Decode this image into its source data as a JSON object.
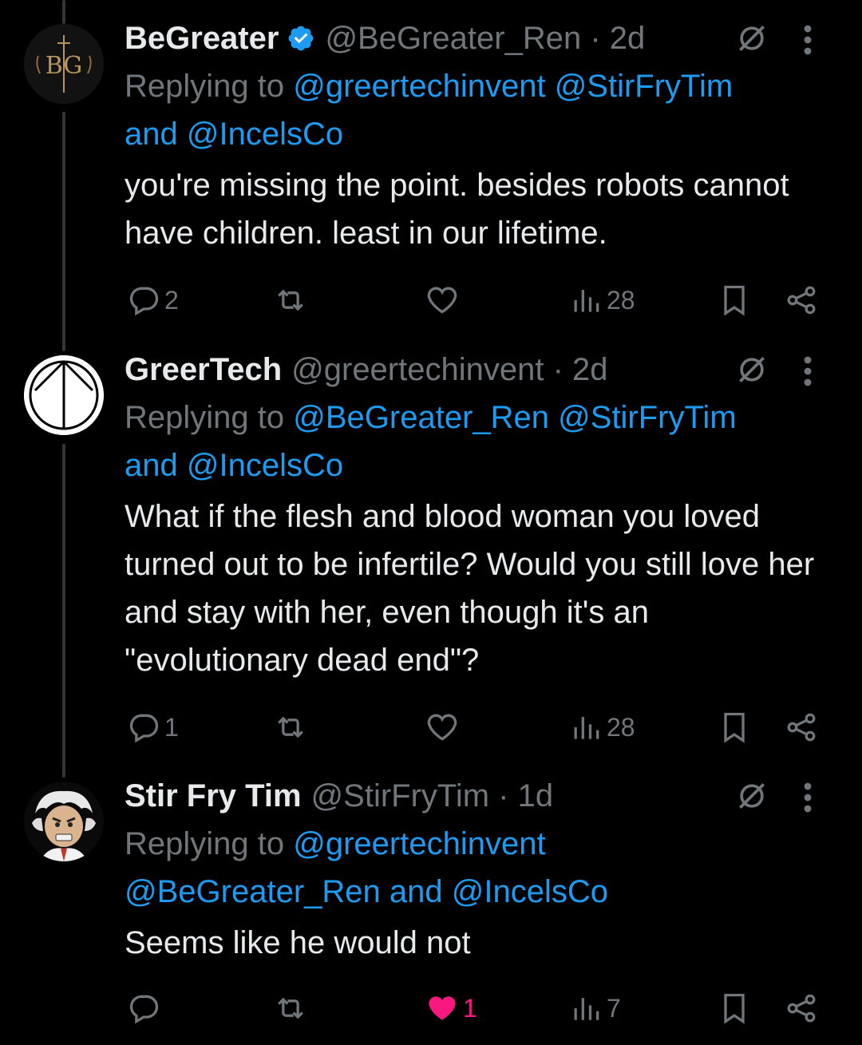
{
  "tweets": [
    {
      "name": "BeGreater",
      "verified": true,
      "handle": "@BeGreater_Ren · 2d",
      "replying_prefix": "Replying to",
      "mentions_line1": "@greertechinvent @StirFryTim",
      "and_text": "and",
      "mentions_line2": "@IncelsCo",
      "body": "you're missing the point. besides robots cannot have children. least in our lifetime.",
      "avatar_text": "BG",
      "actions": {
        "replies": "2",
        "retweets": "",
        "likes": "",
        "views": "28"
      }
    },
    {
      "name": "GreerTech",
      "verified": false,
      "handle": "@greertechinvent · 2d",
      "replying_prefix": "Replying to",
      "mentions_line1": "@BeGreater_Ren @StirFryTim",
      "and_text": "and",
      "mentions_line2": "@IncelsCo",
      "body": "What if the flesh and blood woman you loved turned out to be infertile? Would you still love her and stay with her, even though it's an \"evolutionary dead end\"?",
      "actions": {
        "replies": "1",
        "retweets": "",
        "likes": "",
        "views": "28"
      }
    },
    {
      "name": "Stir Fry Tim",
      "verified": false,
      "handle": "@StirFryTim · 1d",
      "replying_prefix": "Replying to",
      "mentions_line1": "@greertechinvent",
      "mentions_line2a": "@BeGreater_Ren",
      "and_text": "and",
      "mentions_line2": "@IncelsCo",
      "body": "Seems like he would not",
      "actions": {
        "replies": "",
        "retweets": "",
        "likes": "1",
        "views": "7"
      }
    }
  ],
  "colors": {
    "background": "#000000",
    "text": "#e7e9ea",
    "secondary": "#71767b",
    "link": "#1d9bf0",
    "like": "#f91880",
    "verified": "#1d9bf0"
  },
  "icons": [
    "verified-badge-icon",
    "grok-icon",
    "more-icon",
    "reply-icon",
    "retweet-icon",
    "like-icon",
    "views-icon",
    "bookmark-icon",
    "share-icon"
  ]
}
